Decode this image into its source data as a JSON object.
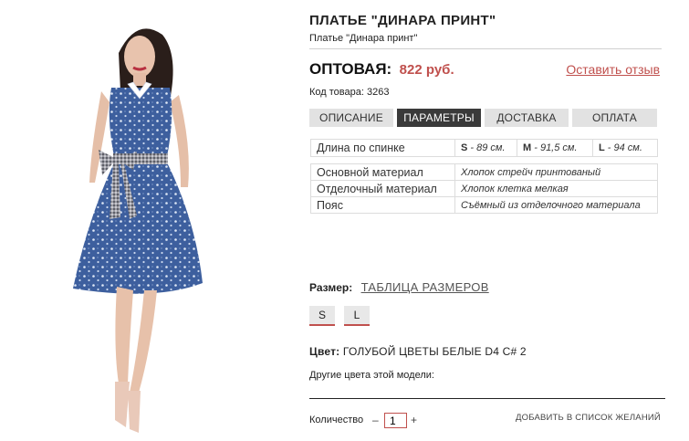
{
  "product": {
    "title": "ПЛАТЬЕ \"ДИНАРА ПРИНТ\"",
    "subtitle": "Платье \"Динара принт\"",
    "price_label": "ОПТОВАЯ:",
    "price_value": "822 руб.",
    "review_link": "Оставить отзыв",
    "sku": "Код товара: 3263"
  },
  "tabs": [
    {
      "label": "ОПИСАНИЕ",
      "active": false
    },
    {
      "label": "ПАРАМЕТРЫ",
      "active": true
    },
    {
      "label": "ДОСТАВКА",
      "active": false
    },
    {
      "label": "ОПЛАТА",
      "active": false
    }
  ],
  "measurements": {
    "label": "Длина по спинке",
    "values": [
      {
        "size": "S",
        "text": " - 89 см."
      },
      {
        "size": "M",
        "text": " - 91,5 см."
      },
      {
        "size": "L",
        "text": " - 94 см."
      }
    ]
  },
  "params": [
    {
      "label": "Основной материал",
      "value": "Хлопок стрейч принтованый"
    },
    {
      "label": "Отделочный материал",
      "value": "Хлопок клетка мелкая"
    },
    {
      "label": "Пояс",
      "value": "Съёмный из отделочного материала"
    }
  ],
  "size_section": {
    "label": "Размер:",
    "chart_link": "ТАБЛИЦА РАЗМЕРОВ",
    "options": [
      "S",
      "L"
    ]
  },
  "color_section": {
    "label": "Цвет:",
    "value": "ГОЛУБОЙ ЦВЕТЫ БЕЛЫЕ D4 C# 2",
    "other_colors": "Другие цвета этой модели:"
  },
  "purchase": {
    "qty_label": "Количество",
    "minus": "–",
    "qty_value": "1",
    "plus": "+",
    "wishlist": "ДОБАВИТЬ В СПИСОК ЖЕЛАНИЙ"
  },
  "colors": {
    "accent": "#c0504d",
    "tab_active": "#3a3a3a",
    "tab_inactive": "#e2e2e2",
    "dress": "#3b5e9c"
  }
}
